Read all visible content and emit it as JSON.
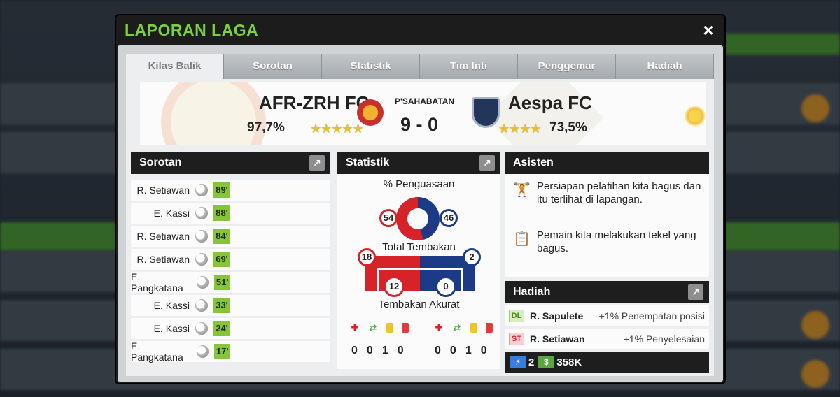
{
  "modal": {
    "title": "LAPORAN LAGA",
    "close_icon": "×"
  },
  "tabs": [
    {
      "label": "Kilas Balik",
      "active": true
    },
    {
      "label": "Sorotan"
    },
    {
      "label": "Statistik"
    },
    {
      "label": "Tim Inti"
    },
    {
      "label": "Penggemar"
    },
    {
      "label": "Hadiah"
    }
  ],
  "match": {
    "home": {
      "name": "AFR-ZRH FC",
      "rating": "97,7%",
      "stars": "★★★★★"
    },
    "away": {
      "name": "Aespa FC",
      "rating": "73,5%",
      "stars": "★★★★"
    },
    "type": "P'SAHABATAN",
    "score": "9 - 0",
    "weather_icon": "sun-icon"
  },
  "highlights": {
    "title": "Sorotan",
    "items": [
      {
        "player": "R. Setiawan",
        "minute": "89'"
      },
      {
        "player": "E. Kassi",
        "minute": "88'"
      },
      {
        "player": "R. Setiawan",
        "minute": "84'"
      },
      {
        "player": "R. Setiawan",
        "minute": "69'"
      },
      {
        "player": "E. Pangkatana",
        "minute": "51'"
      },
      {
        "player": "E. Kassi",
        "minute": "33'"
      },
      {
        "player": "E. Kassi",
        "minute": "24'"
      },
      {
        "player": "E. Pangkatana",
        "minute": "17'"
      }
    ]
  },
  "stats": {
    "title": "Statistik",
    "possession_label": "% Penguasaan",
    "possession_home": "54",
    "possession_away": "46",
    "possession_away_fraction": 0.46,
    "shots_label": "Total Tembakan",
    "shots_home": "18",
    "shots_away": "2",
    "on_target_label": "Tembakan Akurat",
    "on_target_home": "12",
    "on_target_away": "0",
    "home_counts": [
      "0",
      "0",
      "1",
      "0"
    ],
    "away_counts": [
      "0",
      "0",
      "1",
      "0"
    ],
    "home_color": "#d8222a",
    "away_color": "#1d3a86"
  },
  "assistant": {
    "title": "Asisten",
    "tips": [
      "Persiapan pelatihan kita bagus dan itu terlihat di lapangan.",
      "Pemain kita melakukan tekel yang bagus."
    ]
  },
  "rewards": {
    "title": "Hadiah",
    "items": [
      {
        "pos": "DL",
        "player": "R. Sapulete",
        "bonus": "+1% Penempatan posisi"
      },
      {
        "pos": "ST",
        "player": "R. Setiawan",
        "bonus": "+1% Penyelesaian"
      }
    ],
    "energy": "2",
    "cash": "358K"
  }
}
